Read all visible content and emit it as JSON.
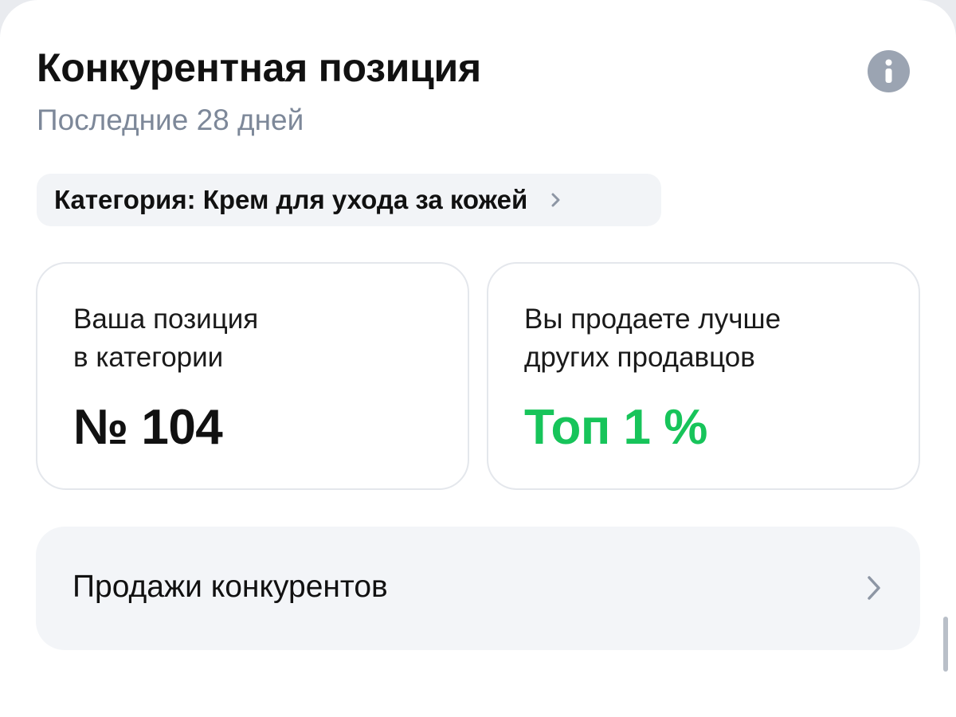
{
  "header": {
    "title": "Конкурентная позиция",
    "subtitle": "Последние 28 дней",
    "info_icon": "info-icon"
  },
  "category_chip": {
    "label": "Категория: Крем для ухода за кожей",
    "icon": "chevron-right-icon"
  },
  "stats": {
    "position": {
      "label_line1": "Ваша позиция",
      "label_line2": "в категории",
      "value": "№ 104"
    },
    "rank": {
      "label_line1": "Вы продаете лучше",
      "label_line2": "других продавцов",
      "value": "Топ 1 %",
      "value_color": "#17c45a"
    }
  },
  "competitors_row": {
    "label": "Продажи конкурентов",
    "icon": "chevron-right-icon"
  },
  "colors": {
    "accent_green": "#17c45a",
    "muted_text": "#7d8899",
    "info_icon_bg": "#9ba4b2",
    "card_border": "#e4e7ec"
  }
}
